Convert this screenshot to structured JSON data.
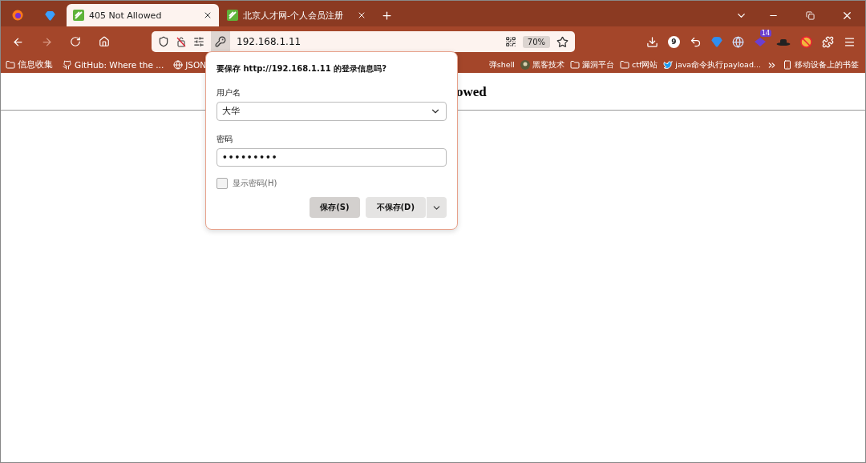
{
  "tabs": [
    {
      "kind": "pinned",
      "selected": false
    },
    {
      "kind": "pinned",
      "selected": false
    },
    {
      "kind": "page",
      "label": "405 Not Allowed",
      "selected": true
    },
    {
      "kind": "page",
      "label": "北京人才网-个人会员注册",
      "selected": false
    }
  ],
  "address_bar": {
    "url": "192.168.1.11",
    "zoom": "70%"
  },
  "extensions": [
    {
      "kind": "download"
    },
    {
      "kind": "counter",
      "badge": "9"
    },
    {
      "kind": "reply"
    },
    {
      "kind": "gem"
    },
    {
      "kind": "globe"
    },
    {
      "kind": "stack",
      "badge": "14"
    },
    {
      "kind": "hat"
    },
    {
      "kind": "blocked"
    },
    {
      "kind": "puzzle"
    }
  ],
  "bookmarks_left": [
    {
      "kind": "folder",
      "label": "信息收集"
    },
    {
      "kind": "github",
      "label": "GitHub: Where the ..."
    },
    {
      "kind": "globe",
      "label": "JSON"
    }
  ],
  "bookmarks_right": [
    {
      "kind": "text",
      "label": "弹shell"
    },
    {
      "kind": "avatar",
      "label": "黑客技术"
    },
    {
      "kind": "folder",
      "label": "漏洞平台"
    },
    {
      "kind": "folder",
      "label": "ctf网站"
    },
    {
      "kind": "bird",
      "label": "java命令执行payload..."
    },
    {
      "kind": "more",
      "label": "移动设备上的书签"
    }
  ],
  "page": {
    "heading": "owed"
  },
  "dialog": {
    "title": "要保存 **http://192.168.1.11** 的登录信息吗?",
    "username_label": "用户名",
    "username": "大华",
    "password_label": "密码",
    "password": "•••••••••",
    "show_password": {
      "label": "显示密码(H)",
      "checked": false
    },
    "buttons": [
      {
        "kind": "primary",
        "label": "保存(S)"
      },
      {
        "kind": "secondary",
        "label": "不保存(D)"
      }
    ]
  }
}
